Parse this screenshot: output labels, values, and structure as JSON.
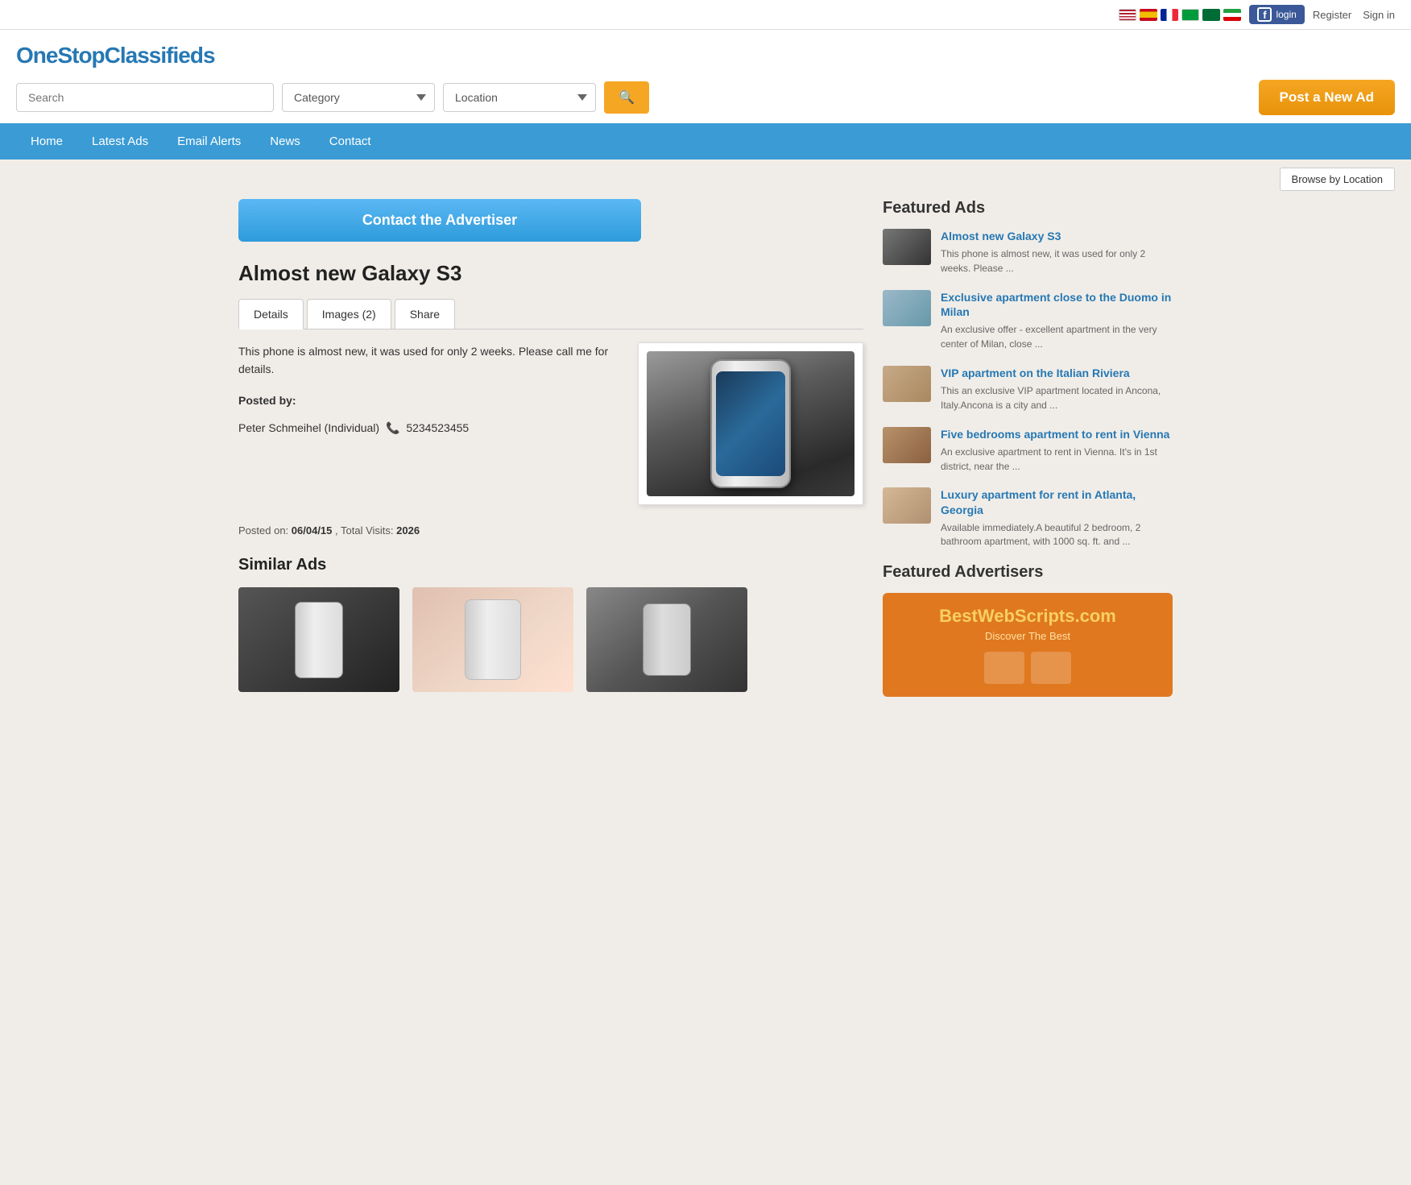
{
  "topbar": {
    "flags": [
      "us",
      "es",
      "fr",
      "br",
      "sa",
      "ir"
    ],
    "fb_login": "login",
    "register": "Register",
    "sign_in": "Sign in"
  },
  "header": {
    "site_title": "OneStopClassifieds",
    "search_placeholder": "Search",
    "category_label": "Category",
    "location_label": "Location",
    "post_btn_label": "Post a New Ad"
  },
  "nav": {
    "items": [
      "Home",
      "Latest Ads",
      "Email Alerts",
      "News",
      "Contact"
    ]
  },
  "browse": {
    "btn_label": "Browse by Location"
  },
  "ad": {
    "contact_btn": "Contact the Advertiser",
    "title": "Almost new Galaxy S3",
    "tabs": [
      "Details",
      "Images (2)",
      "Share"
    ],
    "active_tab": 0,
    "description": "This phone is almost new, it was used for only 2 weeks. Please call me for details.",
    "posted_by_label": "Posted by:",
    "poster_name": "Peter Schmeihel (Individual)",
    "phone_number": "5234523455",
    "posted_date_label": "Posted on:",
    "posted_date": "06/04/15",
    "visits_label": "Total Visits:",
    "visits": "2026"
  },
  "similar_ads": {
    "title": "Similar Ads"
  },
  "sidebar": {
    "featured_ads_title": "Featured Ads",
    "ads": [
      {
        "title": "Almost new Galaxy S3",
        "snippet": "This phone is almost new, it was used for only 2 weeks. Please ...",
        "thumb_class": "thumb-phone"
      },
      {
        "title": "Exclusive apartment close to the Duomo in Milan",
        "snippet": "An exclusive offer - excellent apartment in the very center of Milan, close ...",
        "thumb_class": "thumb-apt1"
      },
      {
        "title": "VIP apartment on the Italian Riviera",
        "snippet": "This an exclusive VIP apartment located in Ancona, Italy.Ancona is a city and ...",
        "thumb_class": "thumb-apt2"
      },
      {
        "title": "Five bedrooms apartment to rent in Vienna",
        "snippet": "An exclusive apartment to rent in Vienna. It's in 1st district, near the ...",
        "thumb_class": "thumb-apt3"
      },
      {
        "title": "Luxury apartment for rent in Atlanta, Georgia",
        "snippet": "Available immediately.A beautiful 2 bedroom, 2 bathroom apartment, with 1000 sq. ft. and ...",
        "thumb_class": "thumb-apt4"
      }
    ],
    "featured_advertisers_title": "Featured Advertisers",
    "advertiser_name": "BestWebScripts",
    "advertiser_tld": ".com",
    "advertiser_sub": "Discover The Best"
  }
}
